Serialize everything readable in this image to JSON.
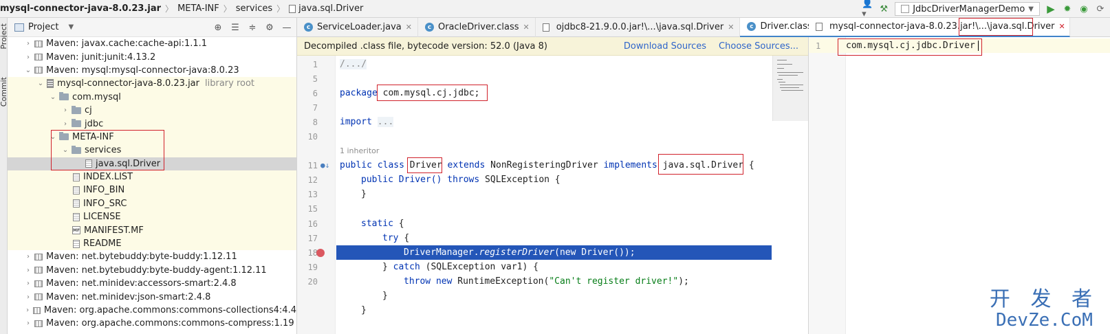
{
  "breadcrumb": [
    "mysql-connector-java-8.0.23.jar",
    "META-INF",
    "services",
    "java.sql.Driver"
  ],
  "toolbar": {
    "run_config": "JdbcDriverManagerDemo"
  },
  "side_strip": {
    "project_label": "Project",
    "commit_label": "Commit"
  },
  "project_panel": {
    "title": "Project"
  },
  "tree": [
    {
      "label": "Maven: javax.cache:cache-api:1.1.1"
    },
    {
      "label": "Maven: junit:junit:4.13.2"
    },
    {
      "label": "Maven: mysql:mysql-connector-java:8.0.23"
    },
    {
      "label": "mysql-connector-java-8.0.23.jar",
      "hint": "library root"
    },
    {
      "label": "com.mysql"
    },
    {
      "label": "cj"
    },
    {
      "label": "jdbc"
    },
    {
      "label": "META-INF"
    },
    {
      "label": "services"
    },
    {
      "label": "java.sql.Driver"
    },
    {
      "label": "INDEX.LIST"
    },
    {
      "label": "INFO_BIN"
    },
    {
      "label": "INFO_SRC"
    },
    {
      "label": "LICENSE"
    },
    {
      "label": "MANIFEST.MF"
    },
    {
      "label": "README"
    },
    {
      "label": "Maven: net.bytebuddy:byte-buddy:1.12.11"
    },
    {
      "label": "Maven: net.bytebuddy:byte-buddy-agent:1.12.11"
    },
    {
      "label": "Maven: net.minidev:accessors-smart:2.4.8"
    },
    {
      "label": "Maven: net.minidev:json-smart:2.4.8"
    },
    {
      "label": "Maven: org.apache.commons:commons-collections4:4.4"
    },
    {
      "label": "Maven: org.apache.commons:commons-compress:1.19"
    }
  ],
  "editor_tabs": [
    "ServiceLoader.java",
    "OracleDriver.class",
    "ojdbc8-21.9.0.0.jar!\\...\\java.sql.Driver",
    "Driver.class"
  ],
  "banner": {
    "text": "Decompiled .class file, bytecode version: 52.0 (Java 8)",
    "download": "Download Sources",
    "choose": "Choose Sources..."
  },
  "code": {
    "l1": "/.../",
    "l6_kw": "package",
    "l6_pkg": "com.mysql.cj.jdbc;",
    "l8_kw": "import",
    "l8_fold": "...",
    "inheritor": "1 inheritor",
    "l11_a": "public class",
    "l11_cls": "Driver",
    "l11_ext": "extends",
    "l11_parent": "NonRegisteringDriver",
    "l11_impl": "implements",
    "l11_iface": "java.sql.Driver",
    "l11_brace": "{",
    "l12_kw": "public",
    "l12_ctor": "Driver()",
    "l12_throws": "throws",
    "l12_rest": "SQLException {",
    "l13": "}",
    "l15_kw": "static",
    "l15_rest": "{",
    "l16_kw": "try",
    "l16_rest": "{",
    "l17_a": "DriverManager.",
    "l17_m": "registerDriver",
    "l17_b": "(new Driver());",
    "l18_a": "} ",
    "l18_kw": "catch",
    "l18_b": "(SQLException var1) {",
    "l19_kw": "throw new",
    "l19_a": "RuntimeException(",
    "l19_str": "\"Can't register driver!\"",
    "l19_b": ");",
    "l20": "}",
    "l21": "}"
  },
  "line_numbers": [
    "1",
    "5",
    "6",
    "7",
    "8",
    "10",
    "11",
    "12",
    "13",
    "15",
    "16",
    "17",
    "18",
    "19",
    "20"
  ],
  "right_tab": {
    "prefix": "mysql-connector-java-8.0.23.jar!\\...",
    "name": "\\java.sql.Driver"
  },
  "right_content": {
    "line_no": "1",
    "text": "com.mysql.cj.jdbc.Driver"
  },
  "watermark": {
    "line1": "开 发 者",
    "line2": "DevZe.CoM"
  }
}
